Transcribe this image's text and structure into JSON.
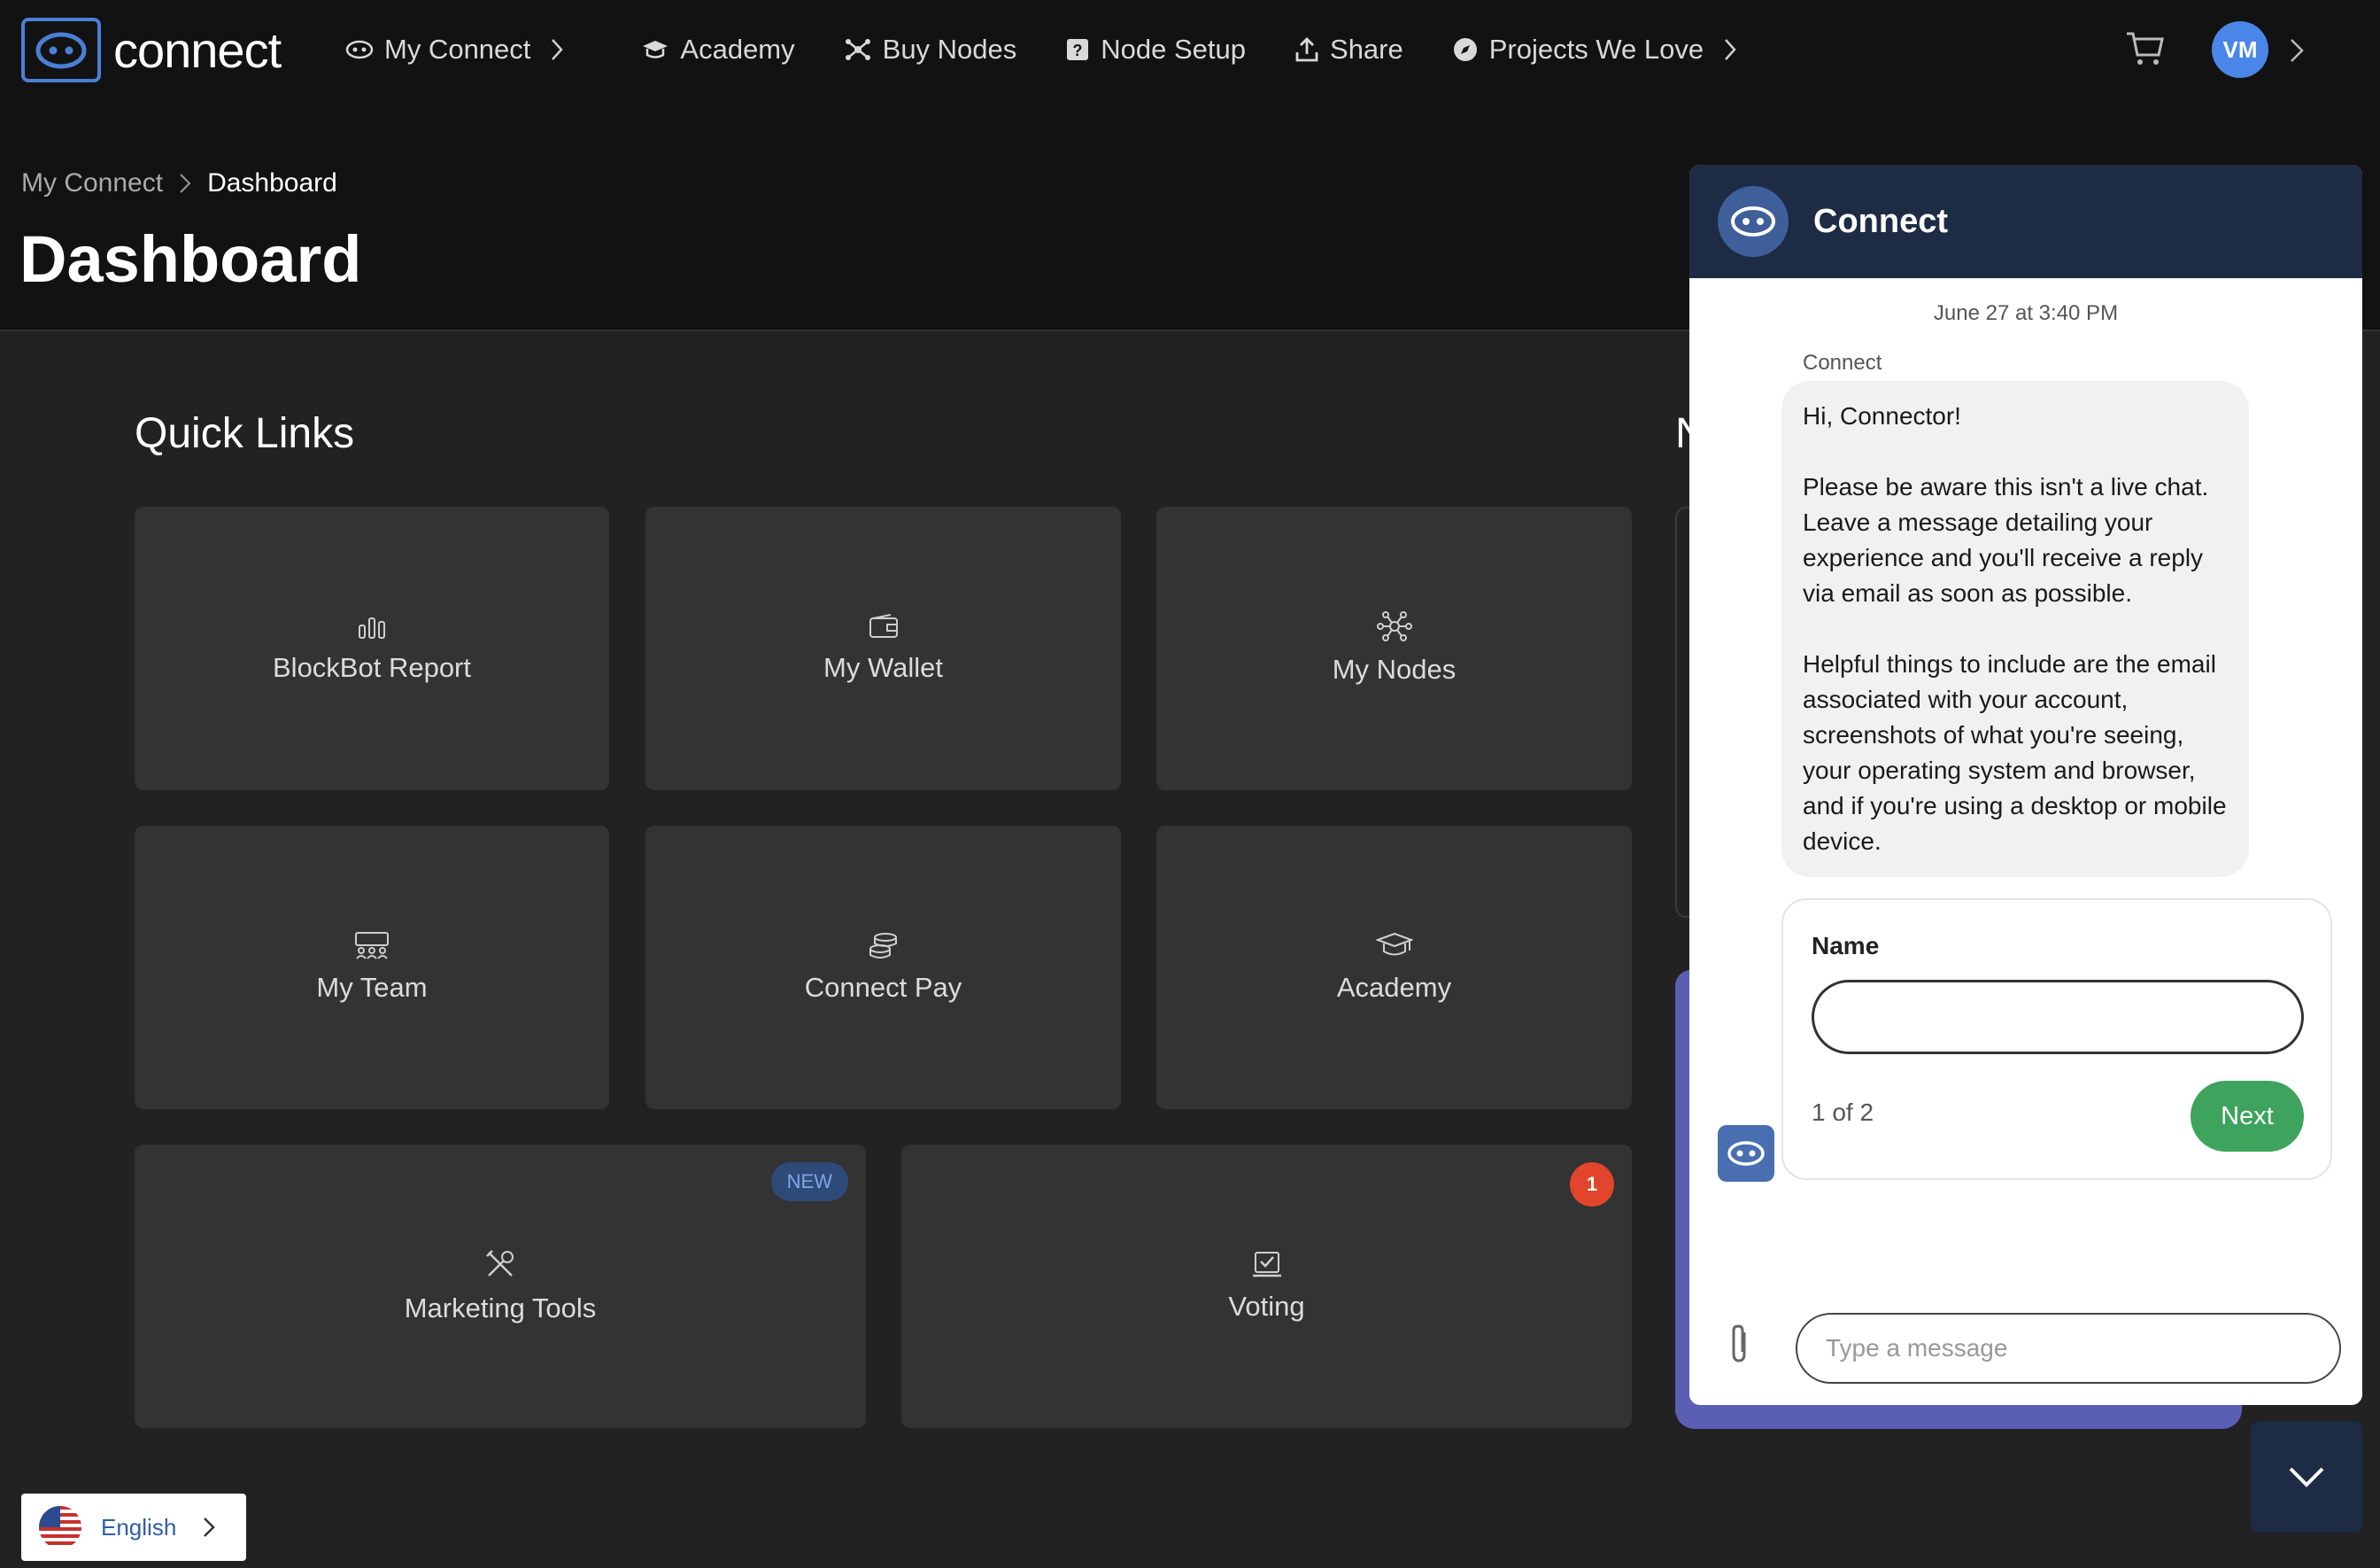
{
  "app": {
    "logo_text": "connect"
  },
  "nav": {
    "items": [
      {
        "label": "My Connect",
        "icon": "eye-logo-icon",
        "has_chevron": true
      },
      {
        "label": "Academy",
        "icon": "graduation-cap-icon"
      },
      {
        "label": "Buy Nodes",
        "icon": "nodes-icon"
      },
      {
        "label": "Node Setup",
        "icon": "question-box-icon"
      },
      {
        "label": "Share",
        "icon": "upload-icon"
      },
      {
        "label": "Projects We Love",
        "icon": "compass-icon",
        "has_chevron": true
      }
    ],
    "cart_icon": "cart-icon",
    "avatar_initials": "VM"
  },
  "breadcrumb": {
    "parent": "My Connect",
    "current": "Dashboard"
  },
  "page": {
    "title": "Dashboard"
  },
  "quick_links": {
    "title": "Quick Links",
    "cards": [
      {
        "label": "BlockBot Report",
        "icon": "bar-chart-icon"
      },
      {
        "label": "My Wallet",
        "icon": "wallet-icon"
      },
      {
        "label": "My Nodes",
        "icon": "network-icon"
      },
      {
        "label": "My Team",
        "icon": "team-icon"
      },
      {
        "label": "Connect Pay",
        "icon": "coins-icon"
      },
      {
        "label": "Academy",
        "icon": "graduation-cap-icon"
      },
      {
        "label": "Marketing Tools",
        "icon": "tools-icon",
        "badge": "NEW"
      },
      {
        "label": "Voting",
        "icon": "ballot-icon",
        "badge": "1"
      }
    ]
  },
  "peek": {
    "letter": "N"
  },
  "chat": {
    "title": "Connect",
    "timestamp": "June 27 at 3:40 PM",
    "sender": "Connect",
    "message": "Hi, Connector!\n\nPlease be aware this isn't a live chat. Leave a message detailing your experience and you'll receive a reply via email as soon as possible.\n\nHelpful things to include are the email associated with your account, screenshots of what you're seeing, your operating system and browser, and if you're using a desktop or mobile device.",
    "form": {
      "label": "Name",
      "value": "",
      "step": "1 of 2",
      "next_label": "Next"
    },
    "input_placeholder": "Type a message"
  },
  "language": {
    "label": "English"
  },
  "colors": {
    "accent": "#4a7fd6",
    "chat_header": "#1d2b45",
    "next_button": "#3da35d",
    "badge_red": "#e2452b"
  }
}
